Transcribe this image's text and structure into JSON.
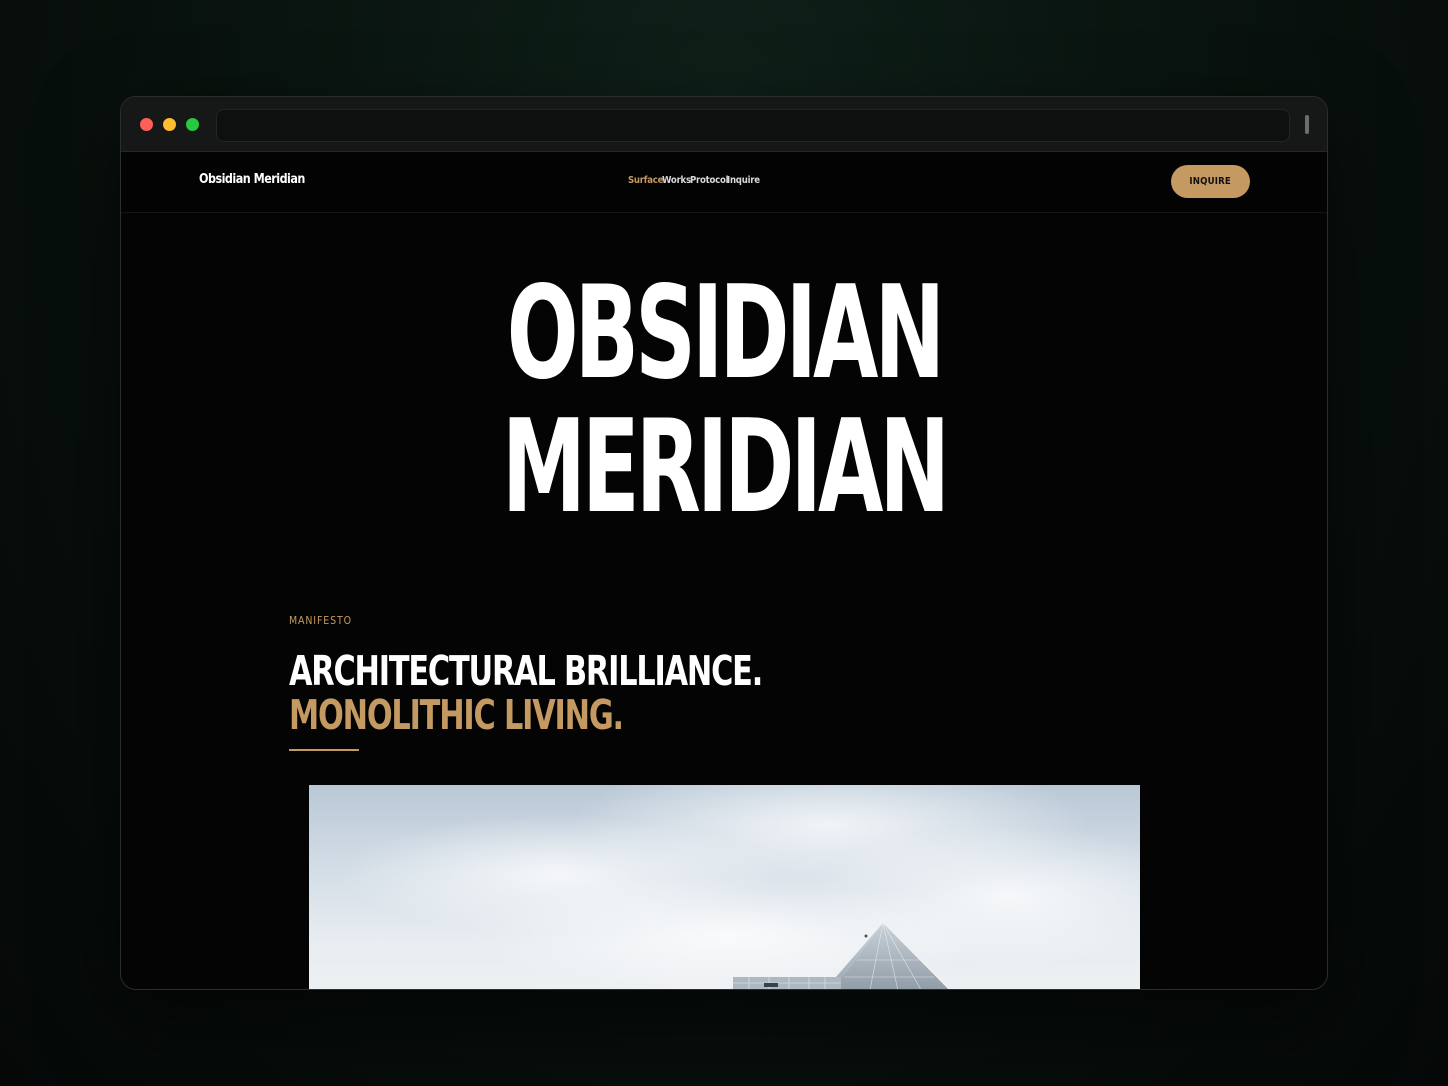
{
  "browser": {
    "controls": [
      "close",
      "minimize",
      "maximize"
    ],
    "address": ""
  },
  "nav": {
    "brand": "Obsidian Meridian",
    "links": [
      {
        "label": "Surface",
        "active": true
      },
      {
        "label": "Works",
        "active": false
      },
      {
        "label": "Protocol",
        "active": false
      },
      {
        "label": "Inquire",
        "active": false
      }
    ],
    "cta_label": "INQUIRE"
  },
  "hero": {
    "line1": "OBSIDIAN",
    "line2": "MERIDIAN"
  },
  "manifesto": {
    "eyebrow": "MANIFESTO",
    "line1": "ARCHITECTURAL BRILLIANCE.",
    "line2": "MONOLITHIC LIVING."
  },
  "colors": {
    "accent": "#c49a62",
    "background": "#040404",
    "text": "#ffffff"
  }
}
